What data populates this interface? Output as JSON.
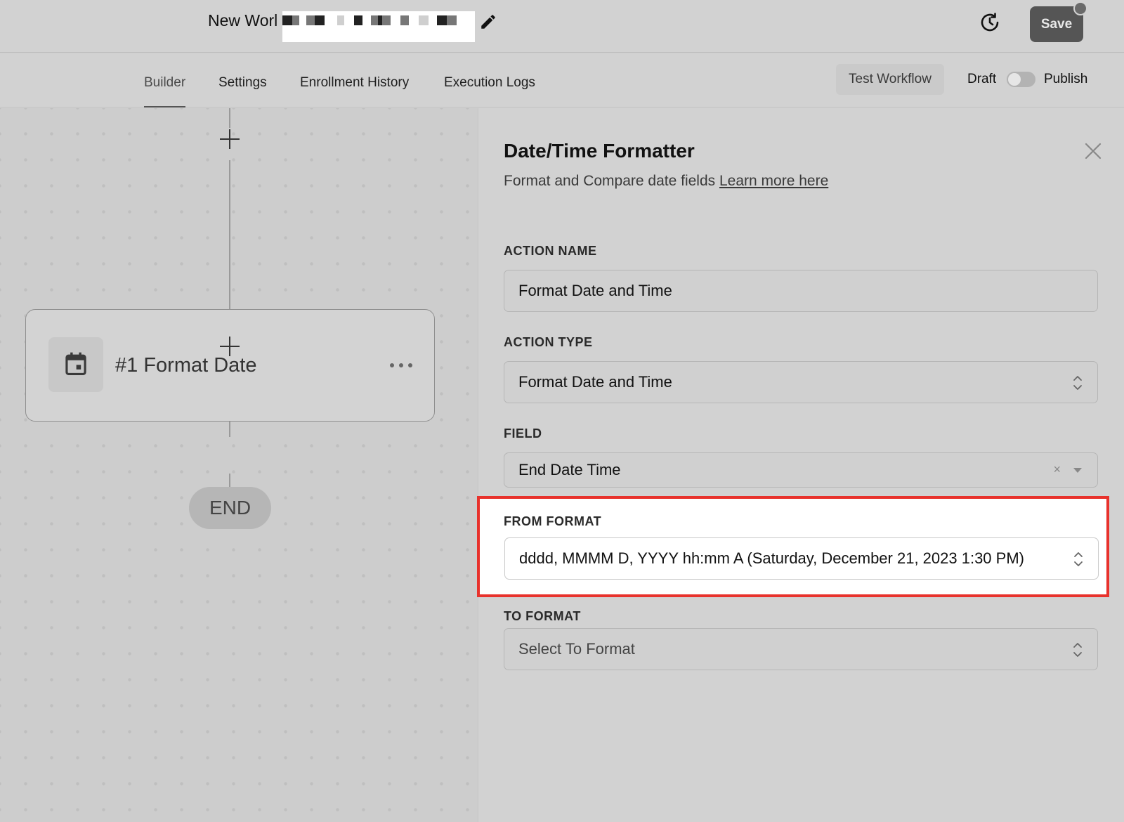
{
  "header": {
    "workflow_title": "New Worl",
    "save_label": "Save"
  },
  "tabs": [
    {
      "label": "Builder",
      "active": true
    },
    {
      "label": "Settings",
      "active": false
    },
    {
      "label": "Enrollment History",
      "active": false
    },
    {
      "label": "Execution Logs",
      "active": false
    }
  ],
  "toolbar": {
    "test_workflow_label": "Test Workflow",
    "draft_label": "Draft",
    "publish_label": "Publish",
    "publish_toggle_on": false
  },
  "canvas": {
    "node_title": "#1 Format Date",
    "node_icon": "calendar-icon",
    "end_label": "END"
  },
  "panel": {
    "title": "Date/Time Formatter",
    "subtitle": "Format and Compare date fields",
    "learn_more": "Learn more here",
    "action_name_label": "ACTION NAME",
    "action_name_value": "Format Date and Time",
    "action_type_label": "ACTION TYPE",
    "action_type_value": "Format Date and Time",
    "field_label": "FIELD",
    "field_value": "End Date Time",
    "from_format_label": "FROM FORMAT",
    "from_format_value": "dddd, MMMM D, YYYY hh:mm A (Saturday, December 21, 2023 1:30 PM)",
    "to_format_label": "TO FORMAT",
    "to_format_placeholder": "Select To Format"
  },
  "colors": {
    "highlight": "#e8322c",
    "save_button": "#555555"
  }
}
